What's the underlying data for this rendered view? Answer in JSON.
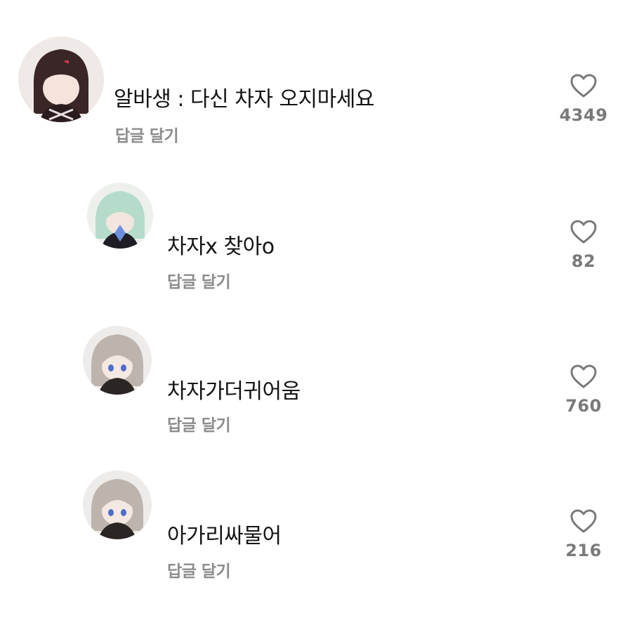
{
  "comments": [
    {
      "avatar": "avatar-dark-hair-chibi",
      "text": "알바생 : 다신 차자 오지마세요",
      "reply_label": "답글 달기",
      "like_icon": "heart-icon",
      "likes": "4349"
    },
    {
      "avatar": "avatar-mint-hair-chibi",
      "text": "차자x 찾아o",
      "reply_label": "답글 달기",
      "like_icon": "heart-icon",
      "likes": "82"
    },
    {
      "avatar": "avatar-grey-hair-chibi",
      "text": "차자가더귀어움",
      "reply_label": "답글 달기",
      "like_icon": "heart-icon",
      "likes": "760"
    },
    {
      "avatar": "avatar-grey-hair-chibi",
      "text": "아가리싸물어",
      "reply_label": "답글 달기",
      "like_icon": "heart-icon",
      "likes": "216"
    }
  ],
  "colors": {
    "text": "#141414",
    "secondary_text": "#8c8c8c",
    "icon": "#7a7a7a",
    "background": "#ffffff"
  }
}
